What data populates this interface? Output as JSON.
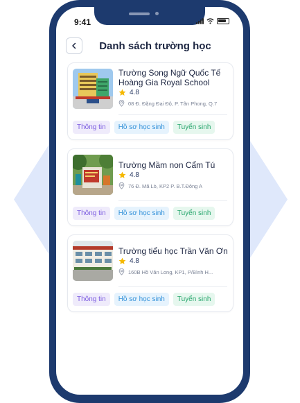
{
  "status_bar": {
    "time": "9:41"
  },
  "header": {
    "title": "Danh sách trường học"
  },
  "schools": [
    {
      "name": "Trường Song Ngữ Quốc Tế Hoàng Gia Royal School",
      "rating": "4.8",
      "address": "08 Đ. Đặng Đại Độ, P. Tân Phong, Q.7",
      "tags": [
        "Thông tin",
        "Hồ sơ học sinh",
        "Tuyển sinh"
      ]
    },
    {
      "name": "Trường Mầm non Cẩm Tú",
      "rating": "4.8",
      "address": "76 Đ. Mã Lò, KP2 P. B.T.Đông A",
      "tags": [
        "Thông tin",
        "Hồ sơ học sinh",
        "Tuyển sinh"
      ]
    },
    {
      "name": "Trường tiểu học Trần Văn Ơn",
      "rating": "4.8",
      "address": "160B Hồ Văn Long, KP1, P/Bình H...",
      "tags": [
        "Thông tin",
        "Hồ sơ học sinh",
        "Tuyển sinh"
      ]
    }
  ],
  "colors": {
    "phone_frame": "#1d3a6e",
    "star": "#f5b800",
    "background_shape": "#dfe8fb"
  },
  "icons": {
    "back": "chevron-left-icon",
    "rating": "star-icon",
    "address": "location-pin-icon"
  }
}
